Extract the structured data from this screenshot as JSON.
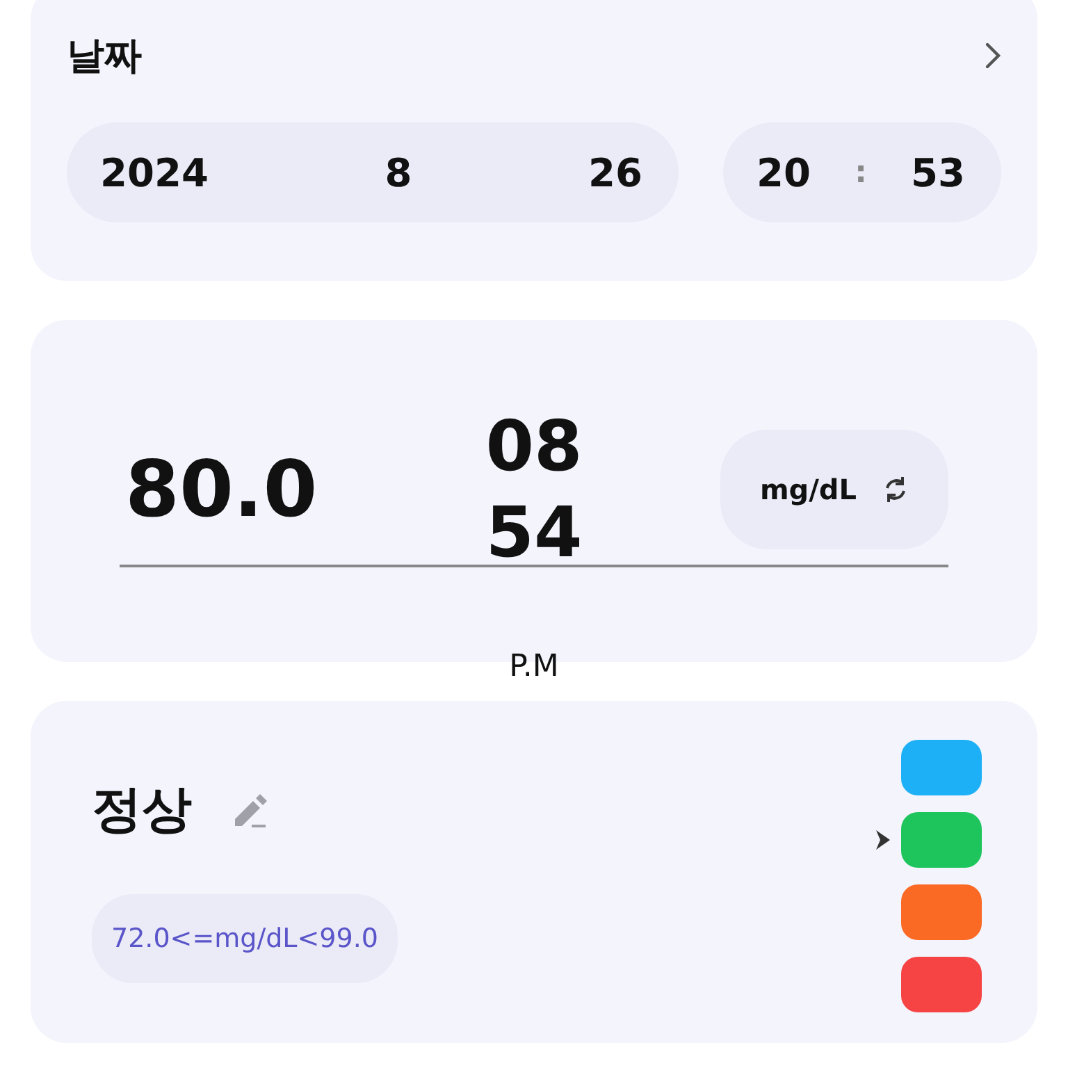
{
  "date_card": {
    "title": "날짜",
    "date": {
      "year": "2024",
      "month": "8",
      "day": "26"
    },
    "time": {
      "hour": "20",
      "separator": ":",
      "minute": "53"
    }
  },
  "reading_card": {
    "value": "80.0",
    "picker": {
      "hour": "08",
      "minute": "54",
      "period": "P.M"
    },
    "unit": "mg/dL"
  },
  "status_card": {
    "label": "정상",
    "range": "72.0<=mg/dL<99.0",
    "levels": [
      {
        "color": "#1eb0f6",
        "selected": false
      },
      {
        "color": "#1ec55c",
        "selected": true
      },
      {
        "color": "#fb6a24",
        "selected": false
      },
      {
        "color": "#f64444",
        "selected": false
      }
    ]
  }
}
